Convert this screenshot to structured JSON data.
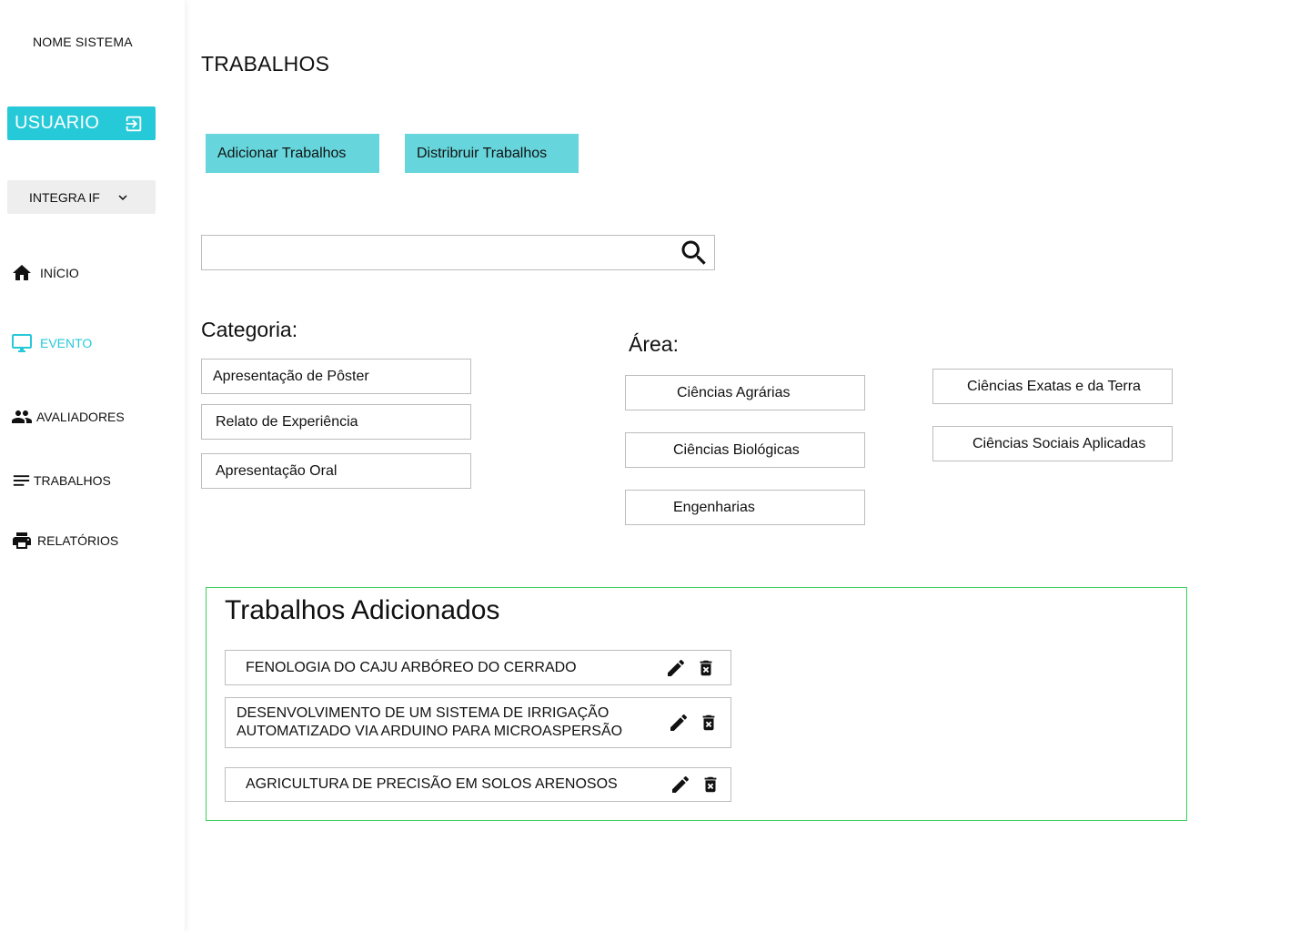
{
  "sidebar": {
    "app_name": "NOME SISTEMA",
    "user_label": "USUARIO",
    "event_selector": "INTEGRA IF",
    "nav": [
      {
        "label": "INÍCIO",
        "icon": "home-icon"
      },
      {
        "label": "EVENTO",
        "icon": "monitor-icon",
        "active": true
      },
      {
        "label": "AVALIADORES",
        "icon": "people-icon"
      },
      {
        "label": "TRABALHOS",
        "icon": "list-icon"
      },
      {
        "label": "RELATÓRIOS",
        "icon": "print-icon"
      }
    ]
  },
  "main": {
    "title": "TRABALHOS",
    "buttons": {
      "add": "Adicionar Trabalhos",
      "distribute": "Distribruir Trabalhos"
    },
    "search": {
      "value": "",
      "placeholder": ""
    },
    "categoria": {
      "label": "Categoria:",
      "items": [
        "Apresentação de Pôster",
        "Relato de Experiência",
        "Apresentação Oral"
      ]
    },
    "area": {
      "label": "Área:",
      "items": [
        "Ciências Agrárias",
        "Ciências Biológicas",
        "Engenharias",
        "Ciências Exatas e da Terra",
        "Ciências Sociais Aplicadas"
      ]
    },
    "added": {
      "title": "Trabalhos Adicionados",
      "items": [
        "FENOLOGIA DO CAJU ARBÓREO DO CERRADO",
        "DESENVOLVIMENTO DE UM SISTEMA DE IRRIGAÇÃO AUTOMATIZADO VIA ARDUINO PARA MICROASPERSÃO",
        "AGRICULTURA DE PRECISÃO EM SOLOS ARENOSOS"
      ]
    }
  },
  "colors": {
    "accent": "#26c9d8",
    "button_bg": "#66d6dc",
    "panel_border": "#3ecf5e"
  }
}
